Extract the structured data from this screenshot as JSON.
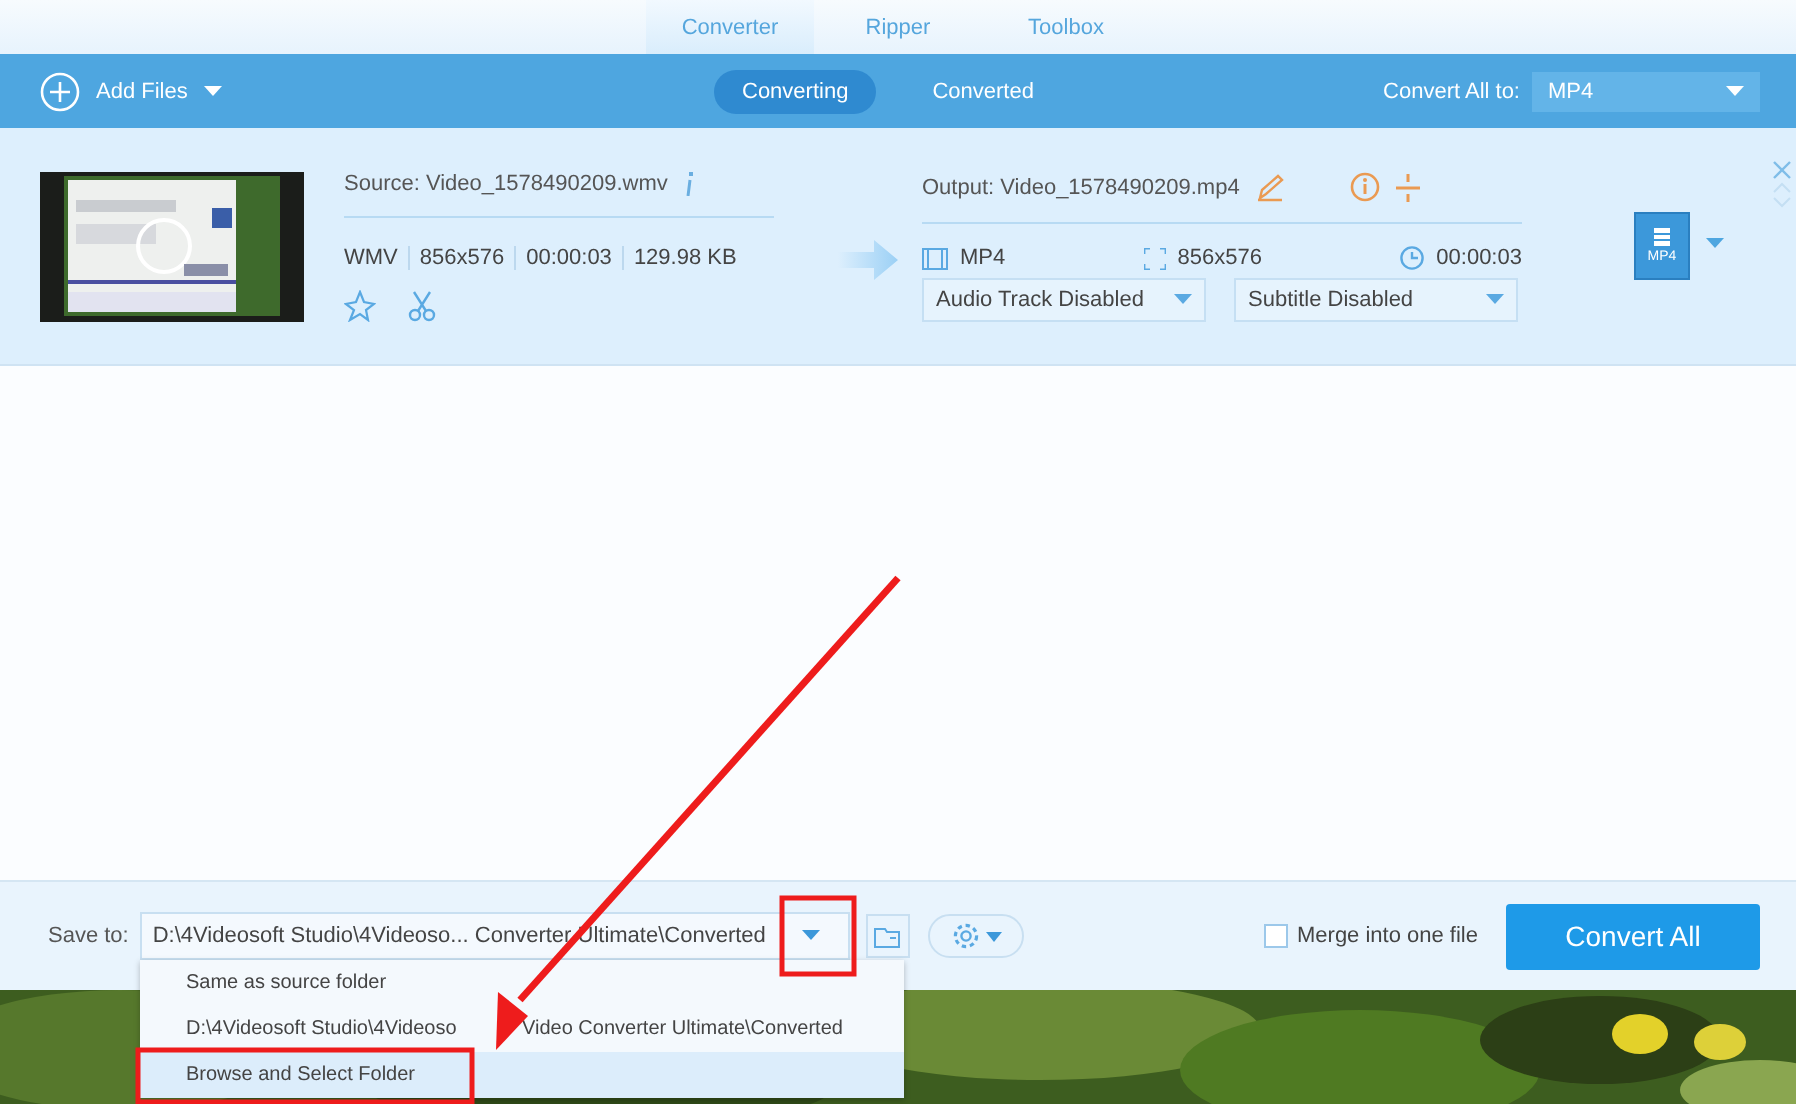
{
  "nav_tabs": [
    {
      "label": "Converter",
      "selected": true
    },
    {
      "label": "Ripper",
      "selected": false
    },
    {
      "label": "Toolbox",
      "selected": false
    }
  ],
  "toolbar": {
    "add_files": "Add Files",
    "view_tabs": [
      {
        "label": "Converting",
        "selected": true
      },
      {
        "label": "Converted",
        "selected": false
      }
    ],
    "convert_all_label": "Convert All to:",
    "format": "MP4"
  },
  "files": [
    {
      "source": "Source: Video_1578490209.wmv",
      "meta": [
        "WMV",
        "856x576",
        "00:00:03",
        "129.98 KB"
      ],
      "output": "Output: Video_1578490209.mp4",
      "out_format": "MP4",
      "out_resolution": "856x576",
      "out_duration": "00:00:03",
      "audio": "Audio Track Disabled",
      "subtitle": "Subtitle Disabled",
      "format_badge": "MP4"
    }
  ],
  "save_bar": {
    "label": "Save to:",
    "path": "D:\\4Videosoft Studio\\4Videoso... Converter Ultimate\\Converted",
    "merge": {
      "label": "Merge into one file",
      "checked": false
    },
    "convert_button": "Convert All"
  },
  "save_menu": [
    {
      "label": "Same as source folder",
      "selected": false
    },
    {
      "label": "D:\\4Videosoft Studio\\4Videoso",
      "label_end": "Video Converter Ultimate\\Converted",
      "selected": false
    },
    {
      "label": "Browse and Select Folder",
      "selected": true
    }
  ]
}
